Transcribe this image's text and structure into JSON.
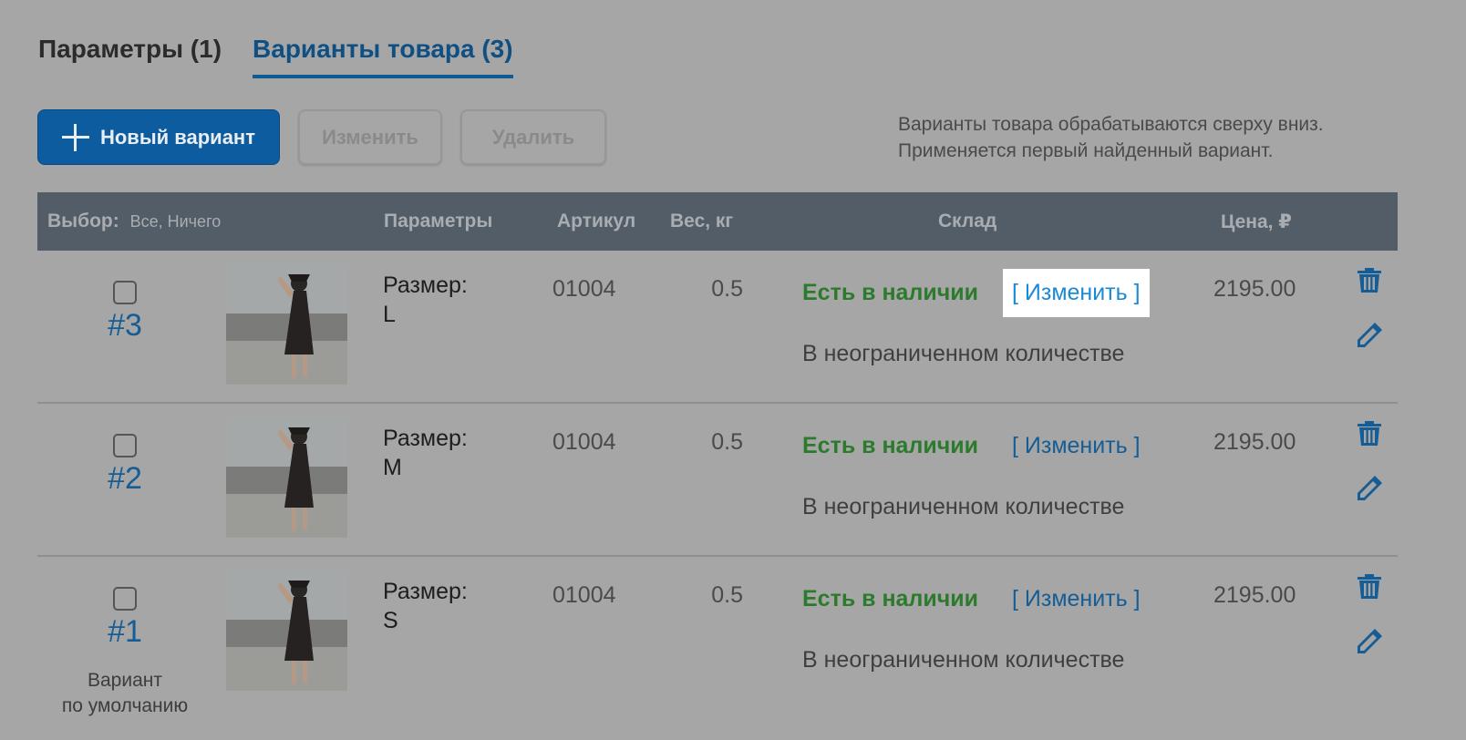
{
  "tabs": [
    {
      "label": "Параметры (1)",
      "active": false
    },
    {
      "label": "Варианты товара (3)",
      "active": true
    }
  ],
  "toolbar": {
    "new_label": "Новый вариант",
    "edit_label": "Изменить",
    "delete_label": "Удалить",
    "new_icon": "plus-icon"
  },
  "note": {
    "line1": "Варианты товара обрабатываются сверху вниз.",
    "line2": "Применяется первый найденный вариант."
  },
  "table": {
    "headers": {
      "select": "Выбор:",
      "select_all": "Все",
      "select_none": "Ничего",
      "params": "Параметры",
      "sku": "Артикул",
      "weight": "Вес, кг",
      "stock": "Склад",
      "price": "Цена, ₽"
    },
    "rows": [
      {
        "num": "#3",
        "param_name": "Размер:",
        "param_value": "L",
        "sku": "01004",
        "weight": "0.5",
        "stock": "Есть в наличии",
        "change": "[ Изменить ]",
        "qty": "В неограниченном количестве",
        "price": "2195.00",
        "default_line1": "",
        "default_line2": ""
      },
      {
        "num": "#2",
        "param_name": "Размер:",
        "param_value": "M",
        "sku": "01004",
        "weight": "0.5",
        "stock": "Есть в наличии",
        "change": "[ Изменить ]",
        "qty": "В неограниченном количестве",
        "price": "2195.00",
        "default_line1": "",
        "default_line2": ""
      },
      {
        "num": "#1",
        "param_name": "Размер:",
        "param_value": "S",
        "sku": "01004",
        "weight": "0.5",
        "stock": "Есть в наличии",
        "change": "[ Изменить ]",
        "qty": "В неограниченном количестве",
        "price": "2195.00",
        "default_line1": "Вариант",
        "default_line2": "по умолчанию"
      }
    ],
    "row_icons": [
      "trash-icon",
      "pencil-icon"
    ]
  },
  "colors": {
    "accent": "#0f5b96",
    "stock_green": "#2c7a2c",
    "header_bg": "#535d68",
    "link_highlight": "#1b8ad4"
  }
}
